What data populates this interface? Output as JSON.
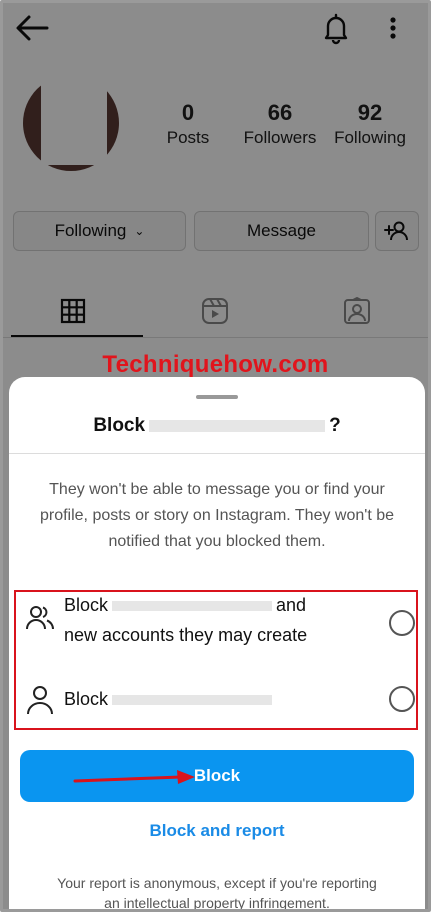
{
  "profile": {
    "stats": [
      {
        "value": "0",
        "label": "Posts"
      },
      {
        "value": "66",
        "label": "Followers"
      },
      {
        "value": "92",
        "label": "Following"
      }
    ],
    "buttons": {
      "following": "Following",
      "message": "Message"
    }
  },
  "watermark": "Techniquehow.com",
  "sheet": {
    "title_prefix": "Block",
    "title_suffix": "?",
    "description": "They won't be able to message you or find your profile, posts or story on Instagram. They won't be notified that you blocked them.",
    "option1": {
      "prefix": "Block",
      "suffix": "and",
      "line2": "new accounts they may create"
    },
    "option2": {
      "prefix": "Block"
    },
    "block_button": "Block",
    "report_link": "Block and report",
    "footnote": "Your report is anonymous, except if you're reporting an intellectual property infringement."
  },
  "colors": {
    "accent": "#0a95f0",
    "link": "#1a8be6",
    "highlight_border": "#d9131c",
    "watermark": "#e1141c"
  },
  "icons": [
    "back-arrow-icon",
    "bell-icon",
    "more-vertical-icon",
    "chevron-down-icon",
    "add-person-icon",
    "grid-icon",
    "reels-icon",
    "tagged-icon",
    "people-icon",
    "person-icon",
    "right-arrow-icon"
  ]
}
